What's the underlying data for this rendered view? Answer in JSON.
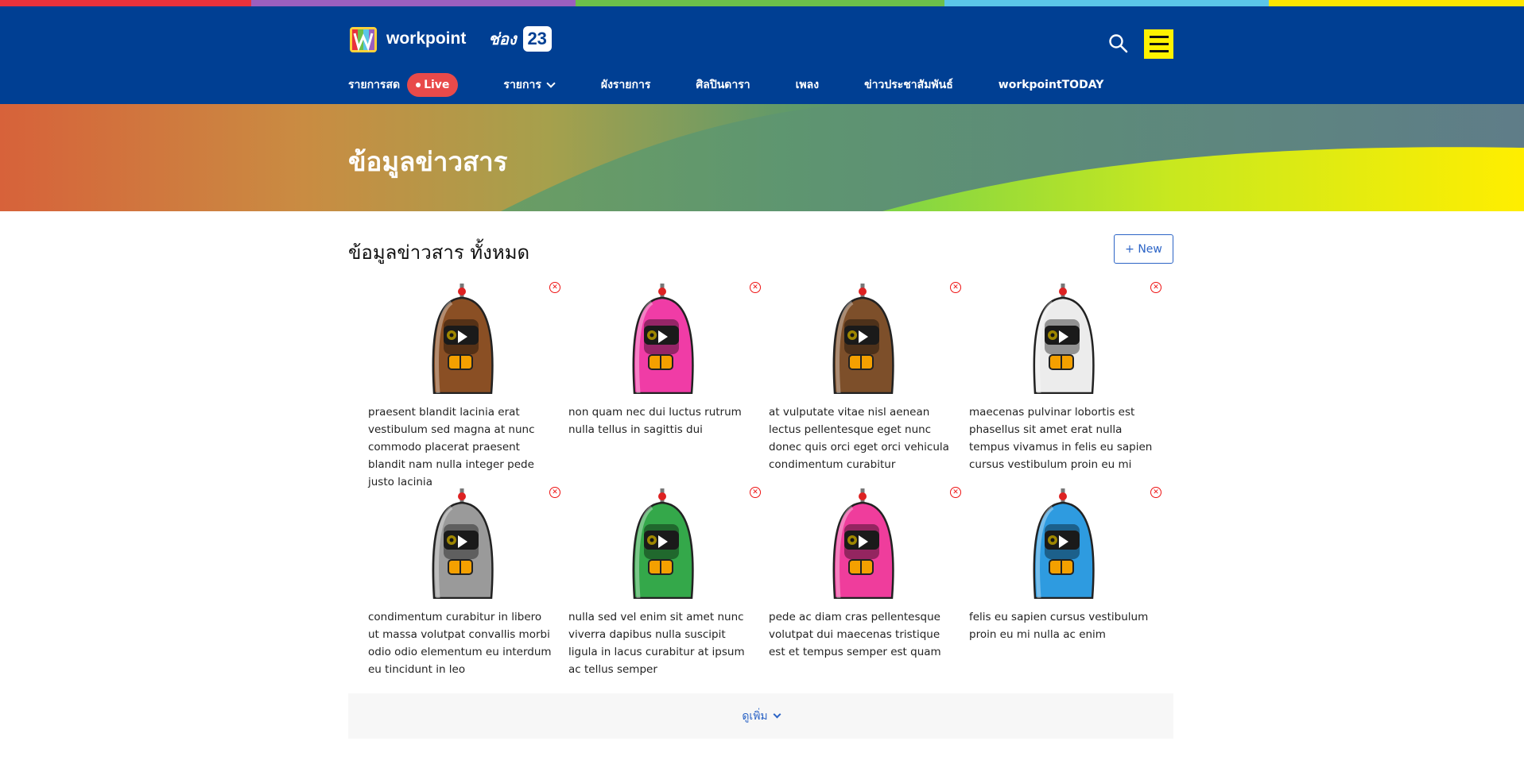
{
  "header": {
    "brand_word": "workpoint",
    "brand_thai": "ช่อง",
    "brand_number": "23",
    "nav": [
      {
        "label": "รายการสด"
      },
      {
        "label": "รายการ"
      },
      {
        "label": "ผังรายการ"
      },
      {
        "label": "ศิลปินดารา"
      },
      {
        "label": "เพลง"
      },
      {
        "label": "ข่าวประชาสัมพันธ์"
      },
      {
        "label": "workpointTODAY"
      }
    ],
    "live_label": "Live"
  },
  "banner": {
    "title": "ข้อมูลข่าวสาร"
  },
  "section": {
    "title": "ข้อมูลข่าวสาร ทั้งหมด",
    "new_button": "+ New"
  },
  "items": [
    {
      "caption": "praesent blandit lacinia erat vestibulum sed magna at nunc commodo placerat praesent blandit nam nulla integer pede justo lacinia",
      "color": "#8a4f24"
    },
    {
      "caption": "non quam nec dui luctus rutrum nulla tellus in sagittis dui",
      "color": "#f03ca6"
    },
    {
      "caption": "at vulputate vitae nisl aenean lectus pellentesque eget nunc donec quis orci eget orci vehicula condimentum curabitur",
      "color": "#7d4f2a"
    },
    {
      "caption": "maecenas pulvinar lobortis est phasellus sit amet erat nulla tempus vivamus in felis eu sapien cursus vestibulum proin eu mi",
      "color": "#ececec"
    },
    {
      "caption": "condimentum curabitur in libero ut massa volutpat convallis morbi odio odio elementum eu interdum eu tincidunt in leo",
      "color": "#9a9a9a"
    },
    {
      "caption": "nulla sed vel enim sit amet nunc viverra dapibus nulla suscipit ligula in lacus curabitur at ipsum ac tellus semper",
      "color": "#34a84a"
    },
    {
      "caption": "pede ac diam cras pellentesque volutpat dui maecenas tristique est et tempus semper est quam",
      "color": "#ef3d9c"
    },
    {
      "caption": "felis eu sapien cursus vestibulum proin eu mi nulla ac enim",
      "color": "#2e9be0"
    }
  ],
  "more": {
    "label": "ดูเพิ่ม"
  },
  "colors": {
    "header_bg": "#003f93",
    "menu_button": "#fff200",
    "live_badge": "#e84a4a",
    "link": "#2c64c6",
    "delete": "#e11111"
  }
}
